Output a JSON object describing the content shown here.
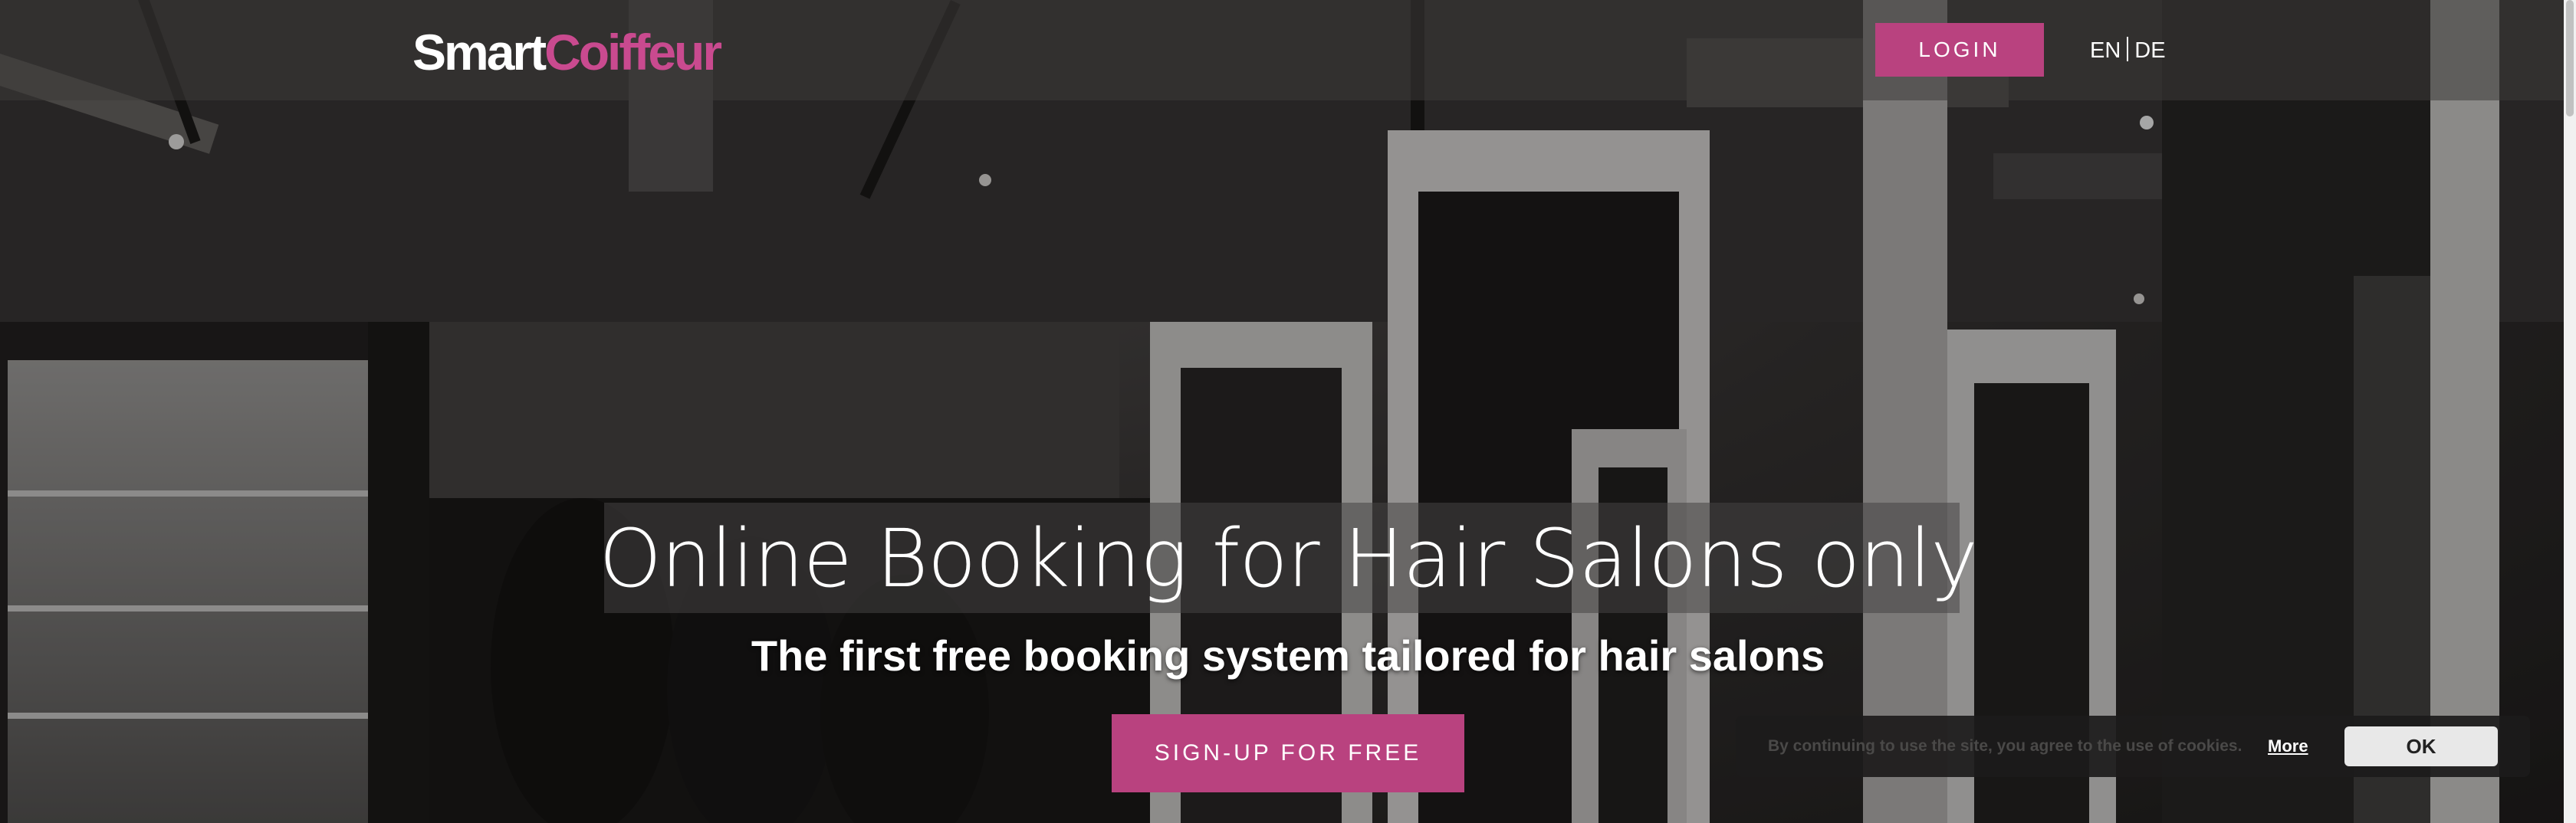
{
  "header": {
    "logo_part1": "Smart",
    "logo_part2": "Coiffeur",
    "login_label": "LOGIN",
    "lang_en": "EN",
    "lang_de": "DE"
  },
  "hero": {
    "headline": "Online Booking for Hair Salons only",
    "subheadline": "The first free booking system tailored for hair salons",
    "signup_label": "SIGN-UP FOR FREE"
  },
  "cookie_banner": {
    "text": "By continuing to use the site, you agree to the use of cookies.",
    "more_label": "More",
    "ok_label": "OK"
  },
  "colors": {
    "brand_pink": "#b9427f",
    "logo_pink": "#c94a8f",
    "text_white": "#ffffff"
  }
}
